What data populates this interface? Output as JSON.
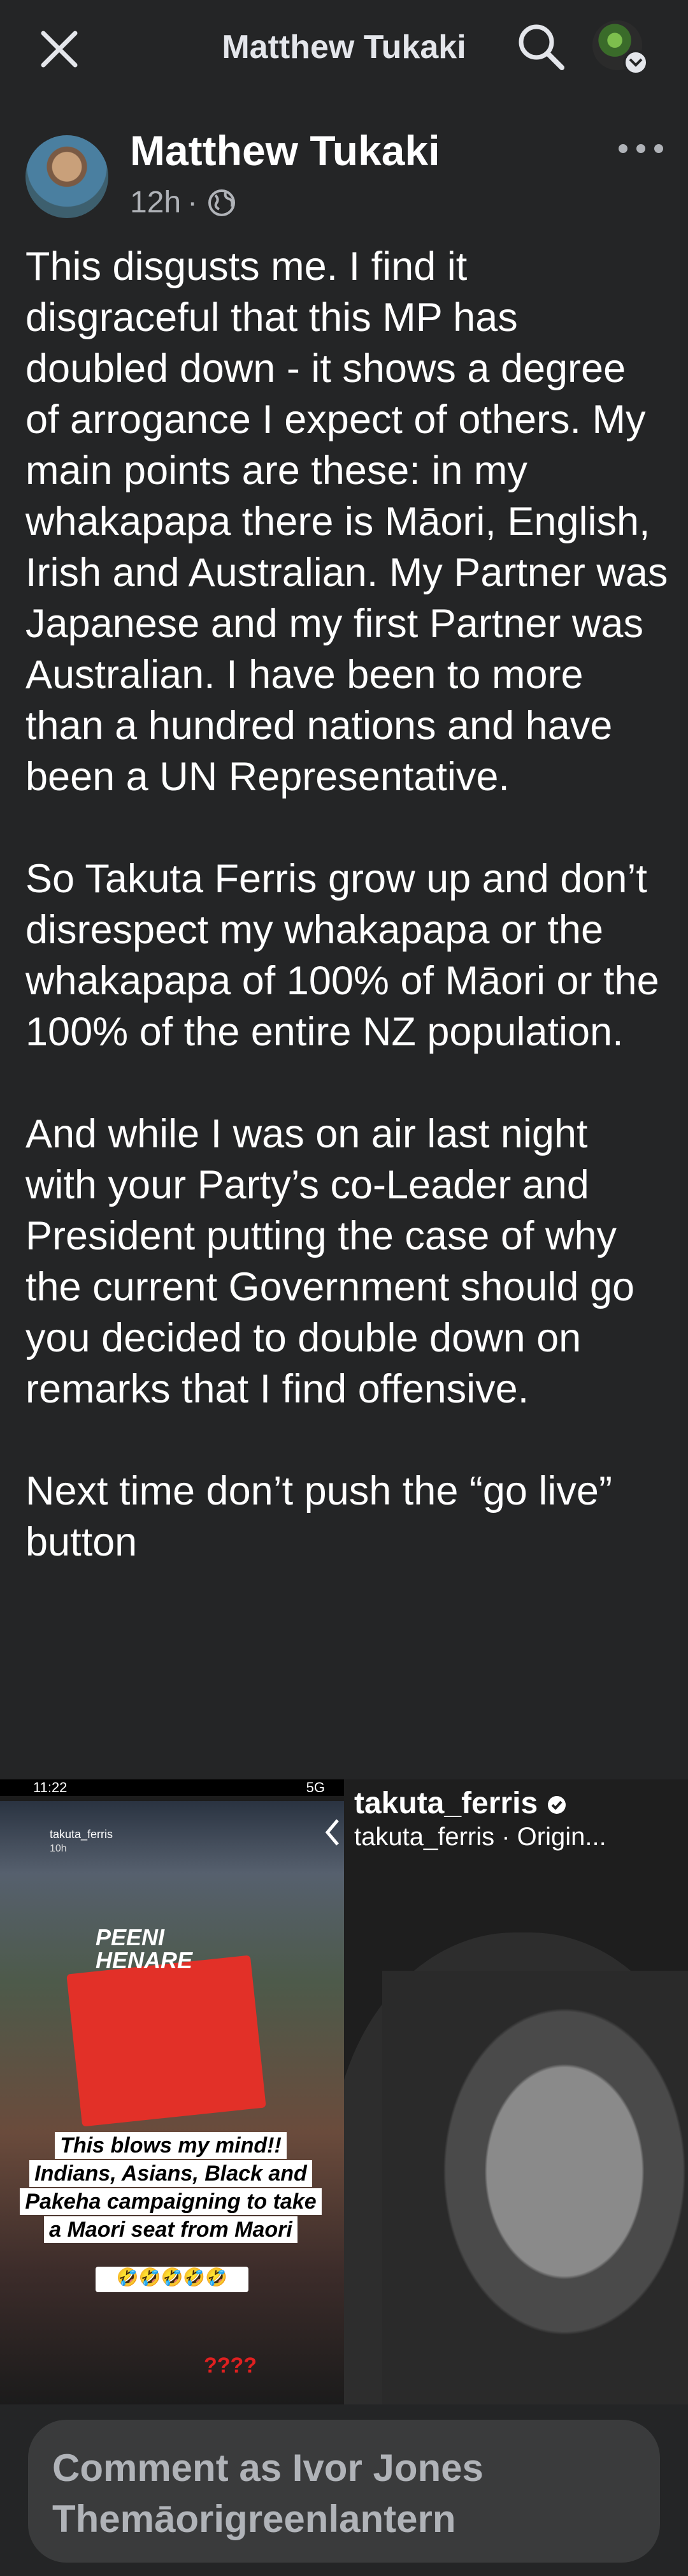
{
  "header": {
    "title": "Matthew Tukaki",
    "icons": {
      "close": "close-icon",
      "search": "search-icon",
      "profile": "profile-avatar"
    }
  },
  "post": {
    "author": "Matthew Tukaki",
    "time": "12h",
    "separator": "·",
    "audience_icon": "globe-icon",
    "paragraphs": [
      "This disgusts me. I find it disgraceful that this MP has doubled down - it shows a degree of arrogance I expect of others. My main points are these: in my whakapapa there is Māori, English, Irish and Australian. My Partner was Japanese and my first Partner was Australian. I have been to more than a hundred nations and have been a UN Representative.",
      "So Takuta Ferris grow up and don’t disrespect my whakapapa or the whakapapa of 100% of Māori or the 100% of the entire NZ population.",
      "And while I was on air last night with your Party’s co-Leader and President putting the case of why the current Government should go you decided to double down on remarks that I find offensive.",
      "Next time don’t push the “go live” button"
    ]
  },
  "media": {
    "left": {
      "status_time": "11:22",
      "status_icons": "5G",
      "story_user": "takuta_ferris",
      "story_time": "10h",
      "sign_text": "PEENI HENARE",
      "caption": "This blows my mind!! Indians, Asians, Black and Pakeha campaigning to take a Maori seat from Maori",
      "emoji": "🤣🤣🤣🤣🤣",
      "question_marks": "????"
    },
    "right": {
      "username": "takuta_ferris",
      "subline": "takuta_ferris · Origin..."
    }
  },
  "comment": {
    "placeholder": "Comment as Ivor Jones Themāorigreenlantern"
  },
  "colors": {
    "background": "#242526",
    "text": "#e4e6eb",
    "muted": "#b0b3b8",
    "comment_bg": "#3a3b3c"
  }
}
